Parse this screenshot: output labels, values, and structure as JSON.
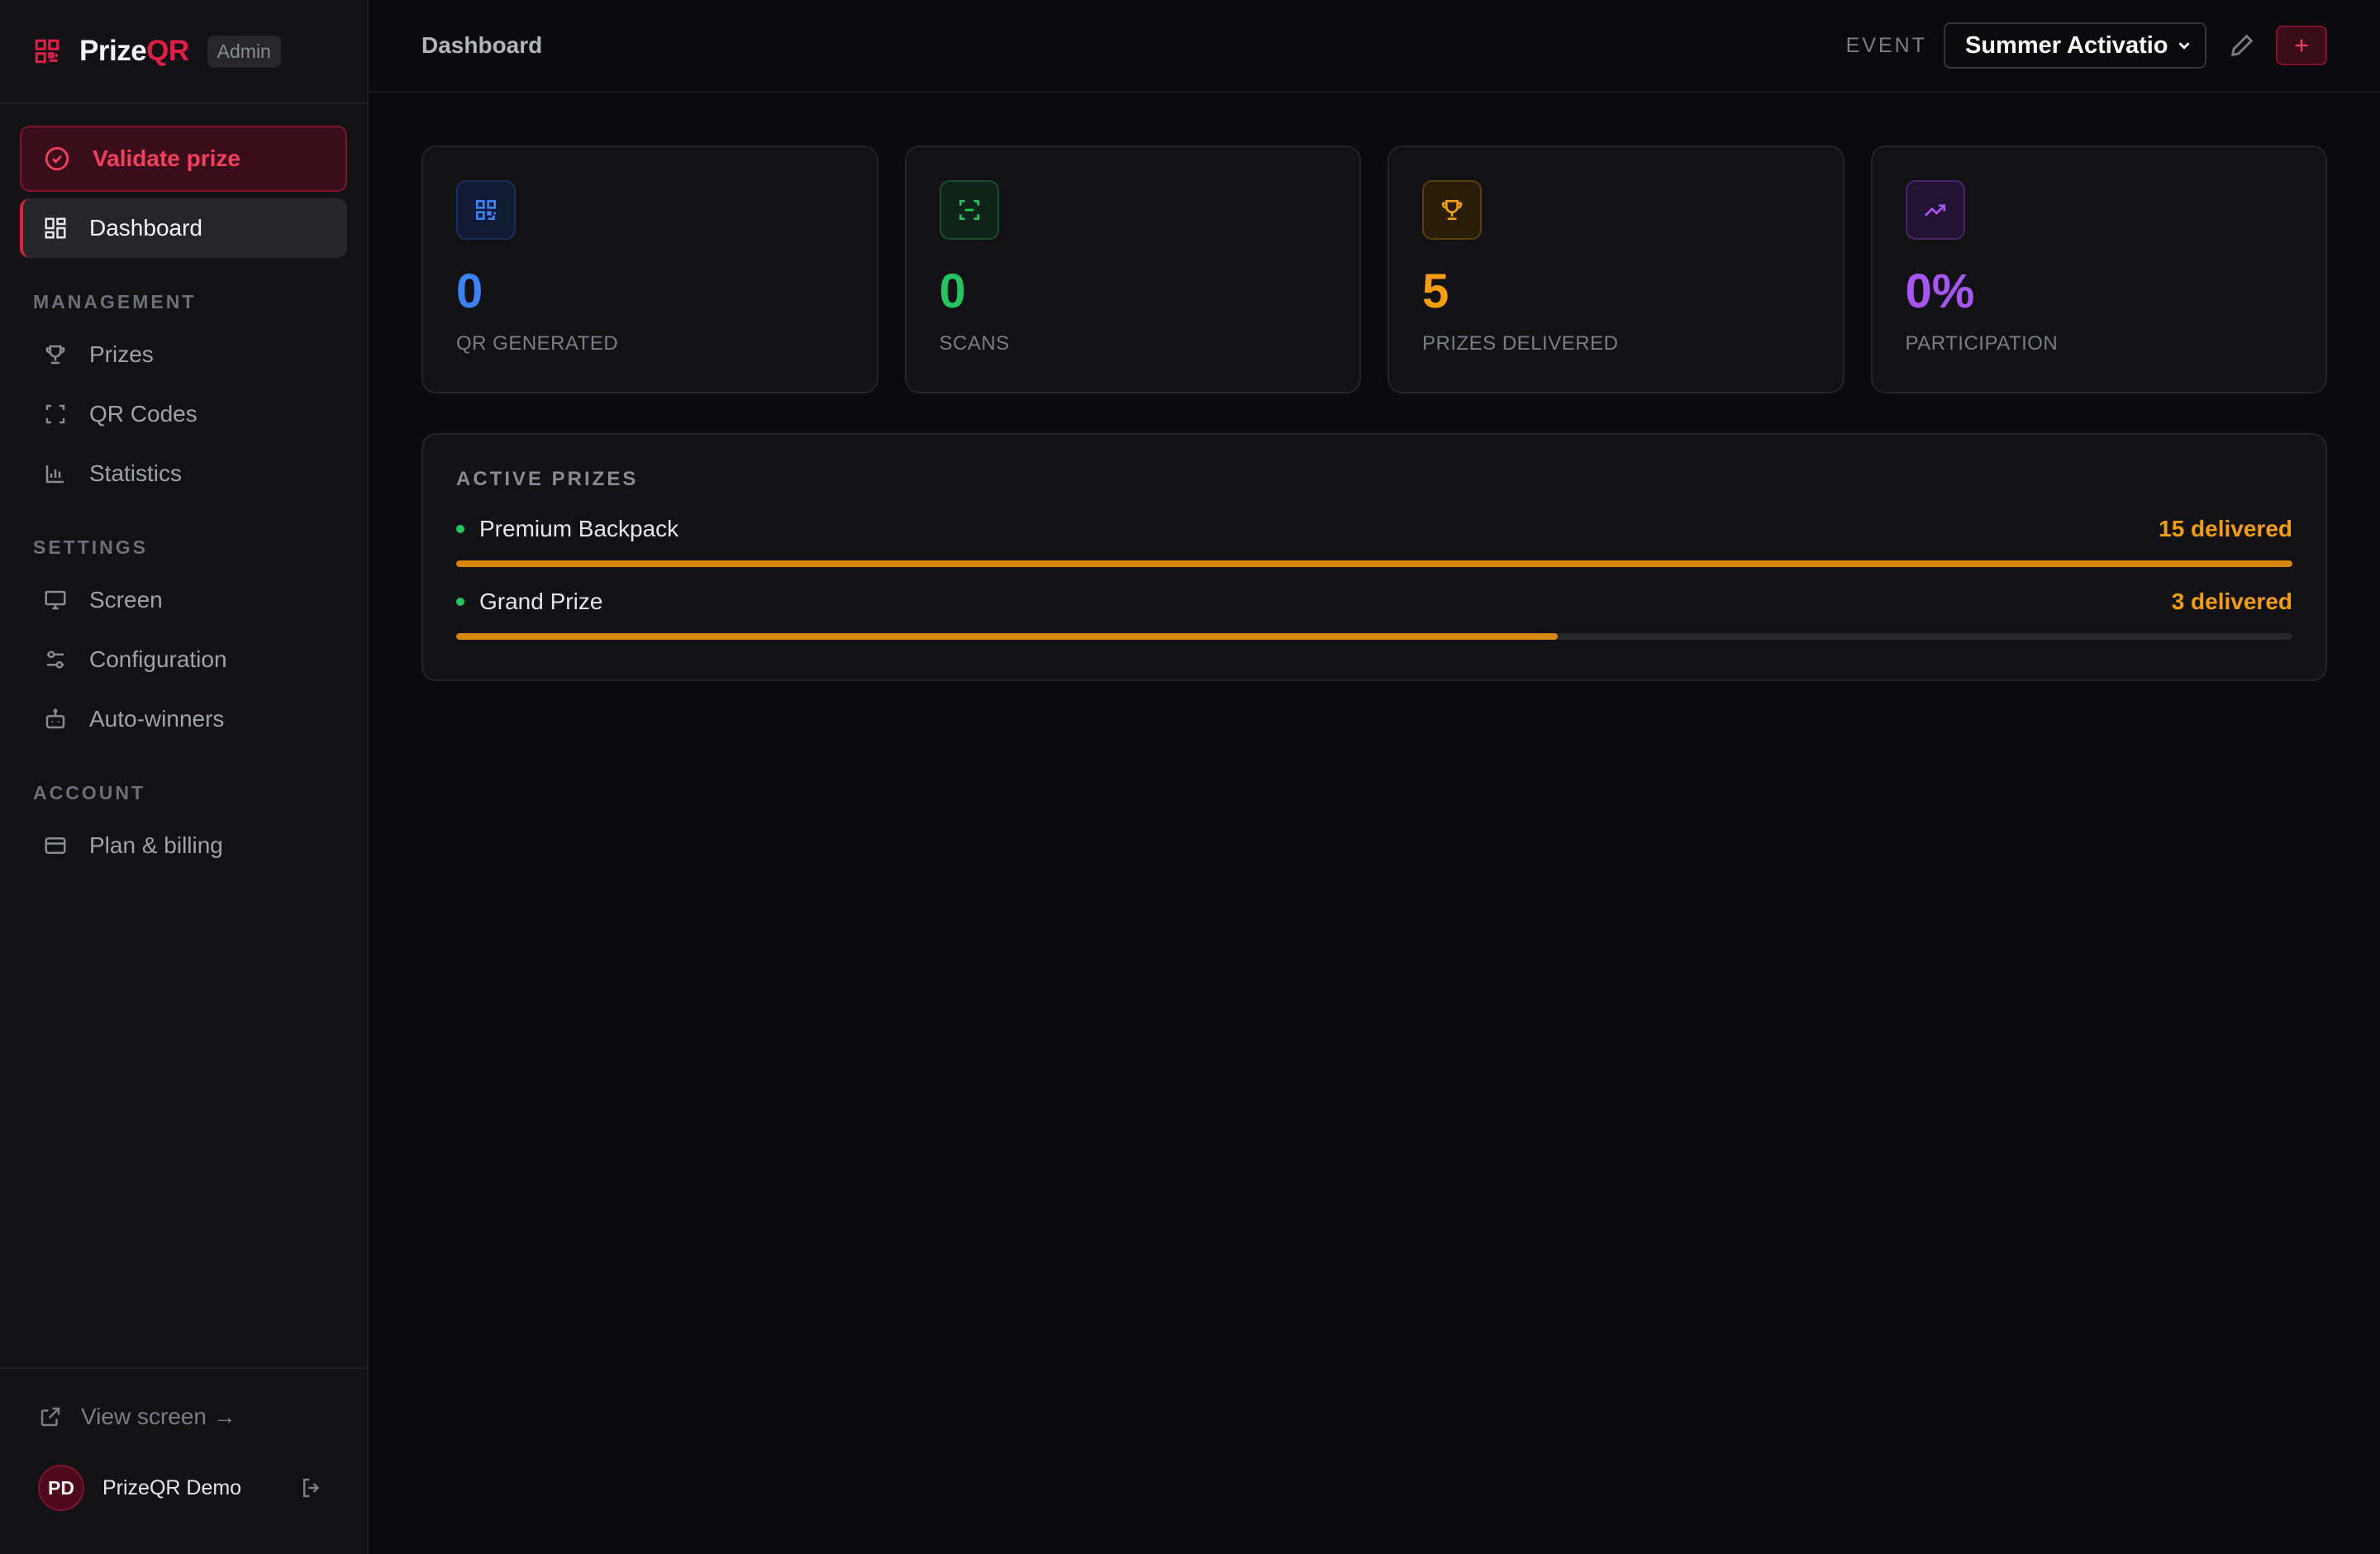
{
  "brand": {
    "name_main": "Prize",
    "name_accent": "QR",
    "badge": "Admin",
    "accent_color": "#e11d48"
  },
  "sidebar": {
    "validate_label": "Validate prize",
    "dashboard_label": "Dashboard",
    "sections": {
      "management": "MANAGEMENT",
      "settings": "SETTINGS",
      "account": "ACCOUNT"
    },
    "items": {
      "prizes": "Prizes",
      "qr_codes": "QR Codes",
      "statistics": "Statistics",
      "screen": "Screen",
      "configuration": "Configuration",
      "auto_winners": "Auto-winners",
      "plan_billing": "Plan & billing"
    },
    "footer": {
      "view_screen": "View screen →",
      "user_initials": "PD",
      "user_name": "PrizeQR Demo"
    }
  },
  "header": {
    "title": "Dashboard",
    "event_label": "EVENT",
    "event_value": "Summer Activation"
  },
  "stats": [
    {
      "value": "0",
      "label": "QR GENERATED",
      "color": "#3b82f6",
      "icon": "qr-icon"
    },
    {
      "value": "0",
      "label": "SCANS",
      "color": "#22c55e",
      "icon": "scan-icon"
    },
    {
      "value": "5",
      "label": "PRIZES DELIVERED",
      "color": "#f59e0b",
      "icon": "trophy-icon"
    },
    {
      "value": "0%",
      "label": "PARTICIPATION",
      "color": "#a855f7",
      "icon": "trending-up-icon"
    }
  ],
  "active_prizes": {
    "title": "ACTIVE PRIZES",
    "items": [
      {
        "name": "Premium Backpack",
        "delivered": "15 delivered",
        "progress_percent": 100
      },
      {
        "name": "Grand Prize",
        "delivered": "3 delivered",
        "progress_percent": 60
      }
    ]
  }
}
